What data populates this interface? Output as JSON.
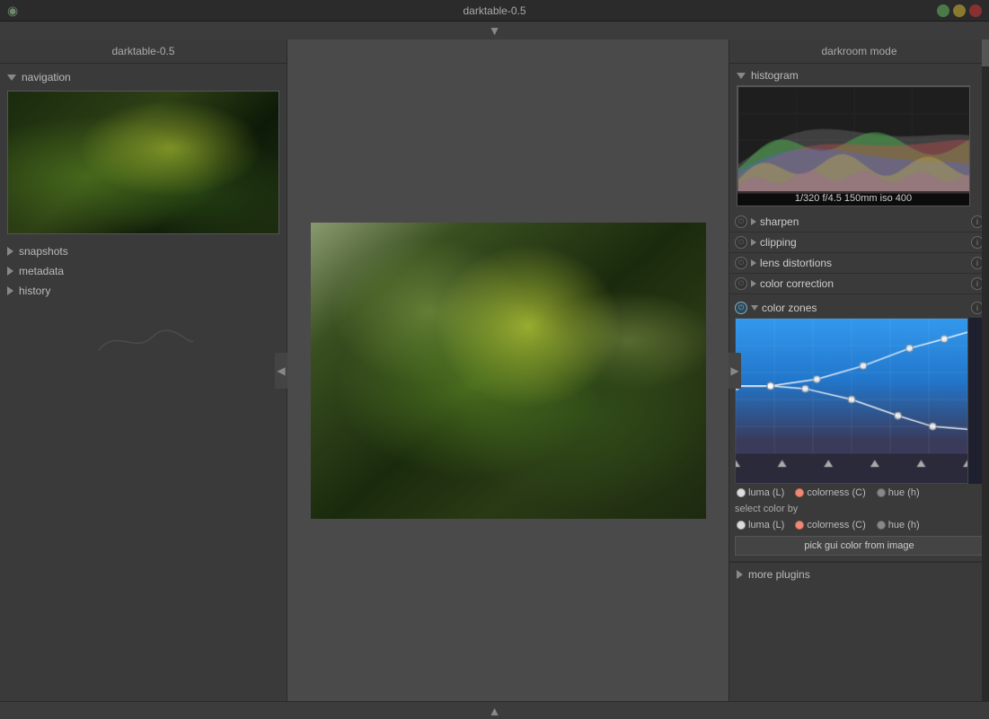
{
  "titlebar": {
    "title": "darktable-0.5",
    "logo": "◉"
  },
  "left_panel": {
    "title": "darktable-0.5",
    "sections": {
      "navigation": {
        "label": "navigation",
        "expanded": true
      },
      "snapshots": {
        "label": "snapshots",
        "expanded": false
      },
      "metadata": {
        "label": "metadata",
        "expanded": false
      },
      "history": {
        "label": "history",
        "expanded": false
      }
    }
  },
  "right_panel": {
    "title": "darkroom mode",
    "histogram": {
      "label": "histogram",
      "info": "1/320 f/4.5 150mm iso 400"
    },
    "modules": [
      {
        "name": "sharpen",
        "active": false,
        "expanded": false
      },
      {
        "name": "clipping",
        "active": false,
        "expanded": false
      },
      {
        "name": "lens distortions",
        "active": false,
        "expanded": false
      },
      {
        "name": "color correction",
        "active": false,
        "expanded": false
      },
      {
        "name": "color zones",
        "active": true,
        "expanded": true
      }
    ],
    "color_zones": {
      "display_options": [
        {
          "label": "luma (L)",
          "color": "white"
        },
        {
          "label": "colorness (C)",
          "color": "orange"
        },
        {
          "label": "hue (h)",
          "color": "gray"
        }
      ],
      "select_color_label": "select color by",
      "select_options": [
        {
          "label": "luma (L)",
          "color": "white"
        },
        {
          "label": "colorness (C)",
          "color": "orange"
        },
        {
          "label": "hue (h)",
          "color": "gray"
        }
      ],
      "pick_button": "pick gui color from image"
    },
    "more_plugins": "more plugins"
  }
}
